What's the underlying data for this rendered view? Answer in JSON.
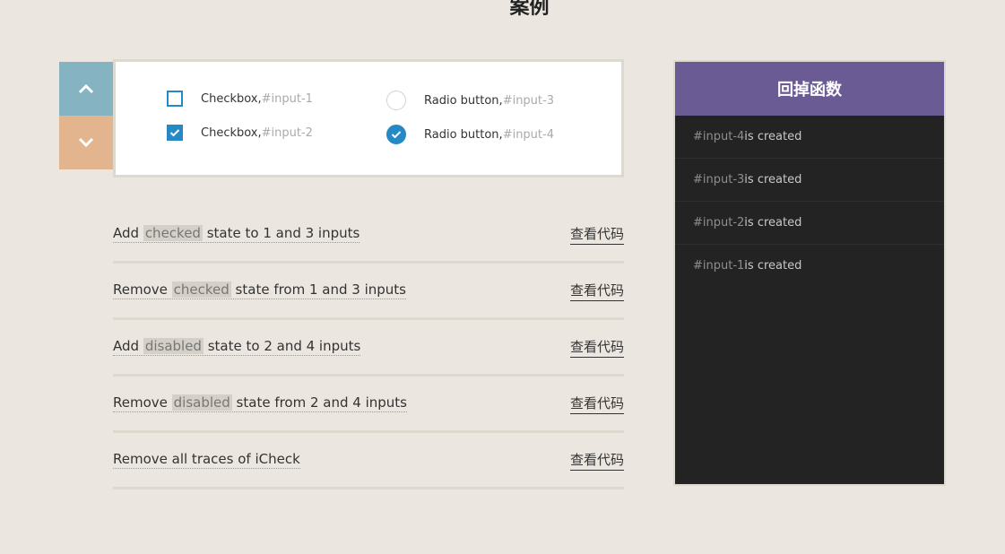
{
  "heading": "案例",
  "arrows": {
    "up_icon": "chevron-up-icon",
    "down_icon": "chevron-down-icon",
    "up_color": "#86b3c1",
    "down_color": "#e3b58f"
  },
  "demo": {
    "checkbox1": {
      "label": "Checkbox, ",
      "id": "#input-1",
      "checked": false
    },
    "checkbox2": {
      "label": "Checkbox, ",
      "id": "#input-2",
      "checked": true
    },
    "radio3": {
      "label": "Radio button, ",
      "id": "#input-3",
      "checked": false
    },
    "radio4": {
      "label": "Radio button, ",
      "id": "#input-4",
      "checked": true
    },
    "accent_color": "#2489c5"
  },
  "actions": [
    {
      "pre": "Add ",
      "hl": "checked",
      "post": " state to 1 and 3 inputs",
      "code": "查看代码"
    },
    {
      "pre": "Remove ",
      "hl": "checked",
      "post": " state from 1 and 3 inputs",
      "code": "查看代码"
    },
    {
      "pre": "Add ",
      "hl": "disabled",
      "post": " state to 2 and 4 inputs",
      "code": "查看代码"
    },
    {
      "pre": "Remove ",
      "hl": "disabled",
      "post": " state from 2 and 4 inputs",
      "code": "查看代码"
    },
    {
      "pre": "Remove all traces of iCheck",
      "hl": "",
      "post": "",
      "code": "查看代码"
    }
  ],
  "callbacks": {
    "title": "回掉函数",
    "header_color": "#6b5b95",
    "log": [
      {
        "id": "#input-4",
        "text": " is created"
      },
      {
        "id": "#input-3",
        "text": " is created"
      },
      {
        "id": "#input-2",
        "text": " is created"
      },
      {
        "id": "#input-1",
        "text": " is created"
      }
    ]
  }
}
